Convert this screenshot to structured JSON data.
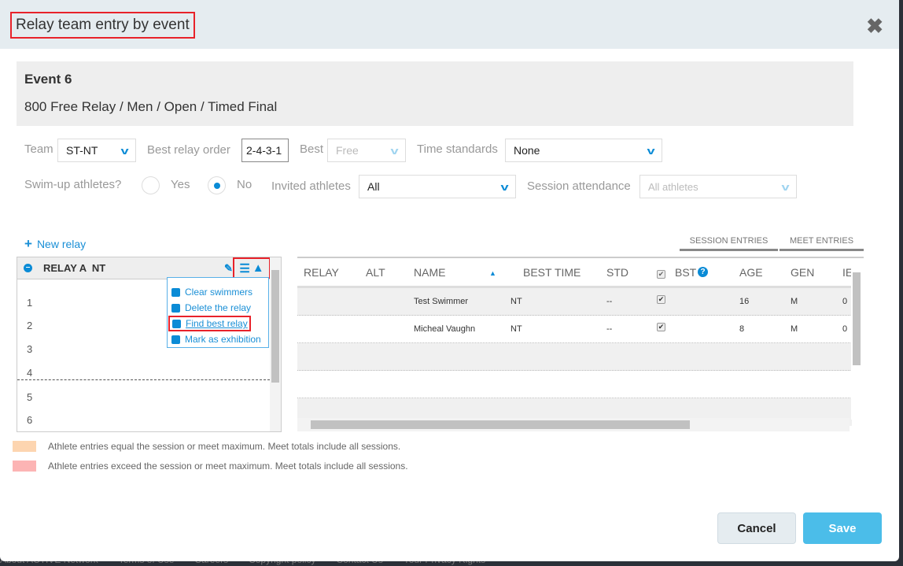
{
  "footer": [
    "About ACTIVE Network",
    "Terms of Use",
    "Careers",
    "Copyright policy",
    "Contact Us",
    "Your Privacy Rights"
  ],
  "modal": {
    "title": "Relay team entry by event"
  },
  "event": {
    "number": "Event 6",
    "description": "800 Free Relay / Men / Open / Timed Final"
  },
  "filters": {
    "team_label": "Team",
    "team_value": "ST-NT",
    "order_label": "Best relay order",
    "order_value": "2-4-3-1",
    "best_label": "Best",
    "best_value": "Free",
    "std_label": "Time standards",
    "std_value": "None",
    "swimup_label": "Swim-up athletes?",
    "yes": "Yes",
    "no": "No",
    "swimup_selected": "No",
    "invited_label": "Invited athletes",
    "invited_value": "All",
    "attend_label": "Session attendance",
    "attend_value": "All athletes"
  },
  "relay": {
    "new_label": "New relay",
    "name": "RELAY A  NT",
    "slots": [
      "1",
      "2",
      "3",
      "4",
      "5",
      "6"
    ],
    "menu": [
      "Clear swimmers",
      "Delete the relay",
      "Find best relay",
      "Mark as exhibition"
    ]
  },
  "tabs": {
    "session": "SESSION ENTRIES",
    "meet": "MEET ENTRIES"
  },
  "grid": {
    "headers": [
      "RELAY",
      "ALT",
      "NAME",
      "BEST TIME",
      "STD",
      "BST",
      "AGE",
      "GEN",
      "IE"
    ],
    "rows": [
      {
        "name": "Test Swimmer",
        "best": "NT",
        "std": "--",
        "bst": true,
        "age": "16",
        "gen": "M",
        "ie": "0"
      },
      {
        "name": "Micheal Vaughn",
        "best": "NT",
        "std": "--",
        "bst": true,
        "age": "8",
        "gen": "M",
        "ie": "0"
      }
    ]
  },
  "legend": [
    {
      "color": "#fdd5b0",
      "text": "Athlete entries equal the session or meet maximum. Meet totals include all sessions."
    },
    {
      "color": "#fcb4b4",
      "text": "Athlete entries exceed the session or meet maximum. Meet totals include all sessions."
    }
  ],
  "buttons": {
    "cancel": "Cancel",
    "save": "Save"
  },
  "colors": {
    "accent": "#0a8bd6",
    "save": "#4bbde9",
    "highlight": "#e8222a"
  }
}
